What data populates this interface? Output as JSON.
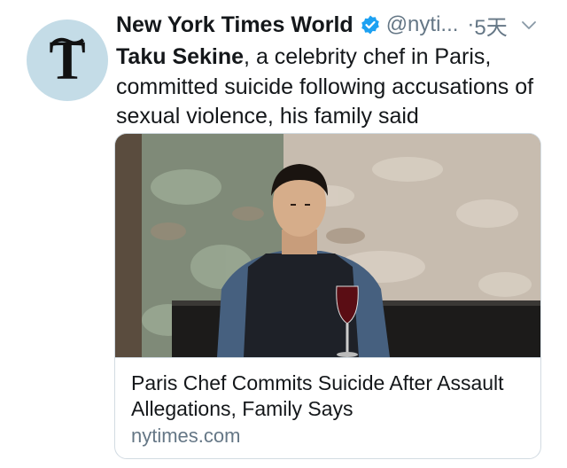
{
  "account": {
    "display_name": "New York Times World",
    "handle": "@nyti...",
    "separator": "·",
    "time_ago": "5天",
    "avatar_icon": "nyt-logo-icon",
    "verified_icon": "verified-badge-icon",
    "menu_icon": "chevron-down-icon"
  },
  "tweet": {
    "text_bold": "Taku Sekine",
    "text_rest": ", a celebrity chef in Paris, committed suicide following accusations of sexual violence, his family said"
  },
  "link_card": {
    "image_description_icon": "chef-photo",
    "title": "Paris Chef Commits Suicide After Assault Allegations, Family Says",
    "domain": "nytimes.com"
  },
  "colors": {
    "verified": "#1da1f2",
    "muted": "#657786",
    "text": "#14171a",
    "avatar_bg": "#c4dce7"
  }
}
